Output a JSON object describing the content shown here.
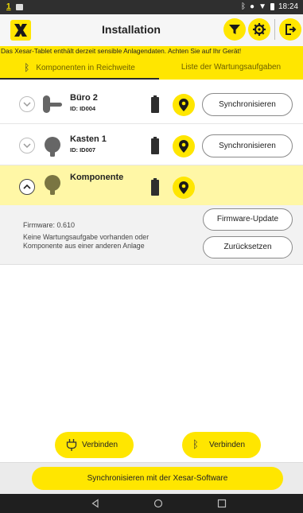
{
  "statusbar": {
    "time": "18:24",
    "notif_glyph": "1"
  },
  "appbar": {
    "title": "Installation"
  },
  "warning": "Das Xesar-Tablet enthält derzeit sensible Anlagendaten. Achten Sie auf Ihr Gerät!",
  "tabs": [
    {
      "label": "Komponenten in Reichweite",
      "active": true
    },
    {
      "label": "Liste der Wartungsaufgaben",
      "active": false
    }
  ],
  "components": [
    {
      "name": "Büro 2",
      "id": "ID: ID004",
      "action": "Synchronisieren"
    },
    {
      "name": "Kasten 1",
      "id": "ID: ID007",
      "action": "Synchronisieren"
    },
    {
      "name": "Komponente",
      "id": "",
      "action": ""
    }
  ],
  "details": {
    "firmware": "Firmware: 0.610",
    "message": "Keine Wartungsaufgabe vorhanden oder Komponente aus einer anderen Anlage",
    "firmware_update": "Firmware-Update",
    "reset": "Zurücksetzen"
  },
  "connect": {
    "usb_label": "Verbinden",
    "bt_label": "Verbinden"
  },
  "footer": {
    "sync_button": "Synchronisieren mit der Xesar-Software"
  },
  "icons": {
    "logo": "xesar-logo-icon",
    "filter": "filter-icon",
    "settings": "gear-icon",
    "logout": "logout-icon",
    "bluetooth": "bluetooth-icon",
    "usb": "usb-plug-icon",
    "location": "location-pin-icon",
    "battery": "battery-icon"
  },
  "colors": {
    "accent": "#ffe600",
    "selected_row": "#fff7a6",
    "details_bg": "#f2f2f2"
  }
}
